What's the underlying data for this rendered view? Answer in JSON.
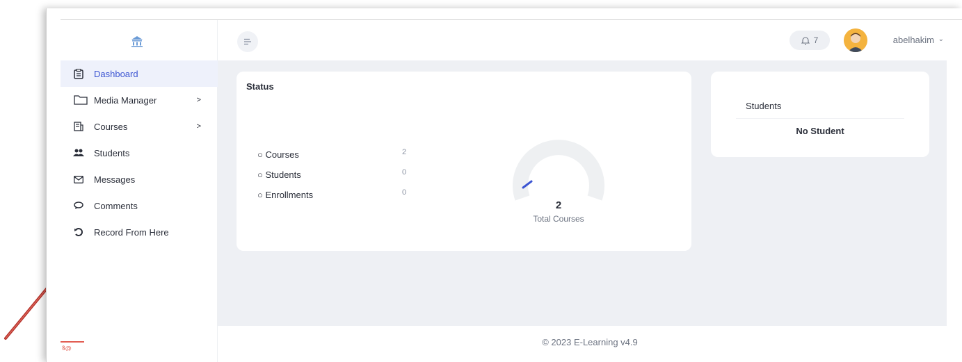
{
  "sidebar": {
    "logo_icon": "school-logo-icon",
    "items": [
      {
        "label": "Dashboard",
        "icon": "clipboard-icon",
        "active": true,
        "has_children": false
      },
      {
        "label": "Media Manager",
        "icon": "folder-icon",
        "active": false,
        "has_children": true
      },
      {
        "label": "Courses",
        "icon": "courses-icon",
        "active": false,
        "has_children": true
      },
      {
        "label": "Students",
        "icon": "users-icon",
        "active": false,
        "has_children": false
      },
      {
        "label": "Messages",
        "icon": "envelope-icon",
        "active": false,
        "has_children": false
      },
      {
        "label": "Comments",
        "icon": "comment-icon",
        "active": false,
        "has_children": false
      },
      {
        "label": "Record From Here",
        "icon": "record-icon",
        "active": false,
        "has_children": false
      }
    ],
    "chevron": ">"
  },
  "header": {
    "notification_count": "7",
    "username": "abelhakim",
    "user_chevron": "⌄"
  },
  "status_card": {
    "title": "Status",
    "stats": [
      {
        "label": "○ Courses",
        "value": "2"
      },
      {
        "label": "○ Students",
        "value": "0"
      },
      {
        "label": "○ Enrollments",
        "value": "0"
      }
    ],
    "gauge_value": "2",
    "gauge_label": "Total Courses",
    "gauge_fraction": 0.02
  },
  "students_card": {
    "title": "Students",
    "empty_text": "No Student"
  },
  "footer": {
    "text": "© 2023 E-Learning v4.9"
  },
  "colors": {
    "accent": "#3c55d2",
    "content_bg": "#eef0f4",
    "pointer": "#c0392b"
  }
}
